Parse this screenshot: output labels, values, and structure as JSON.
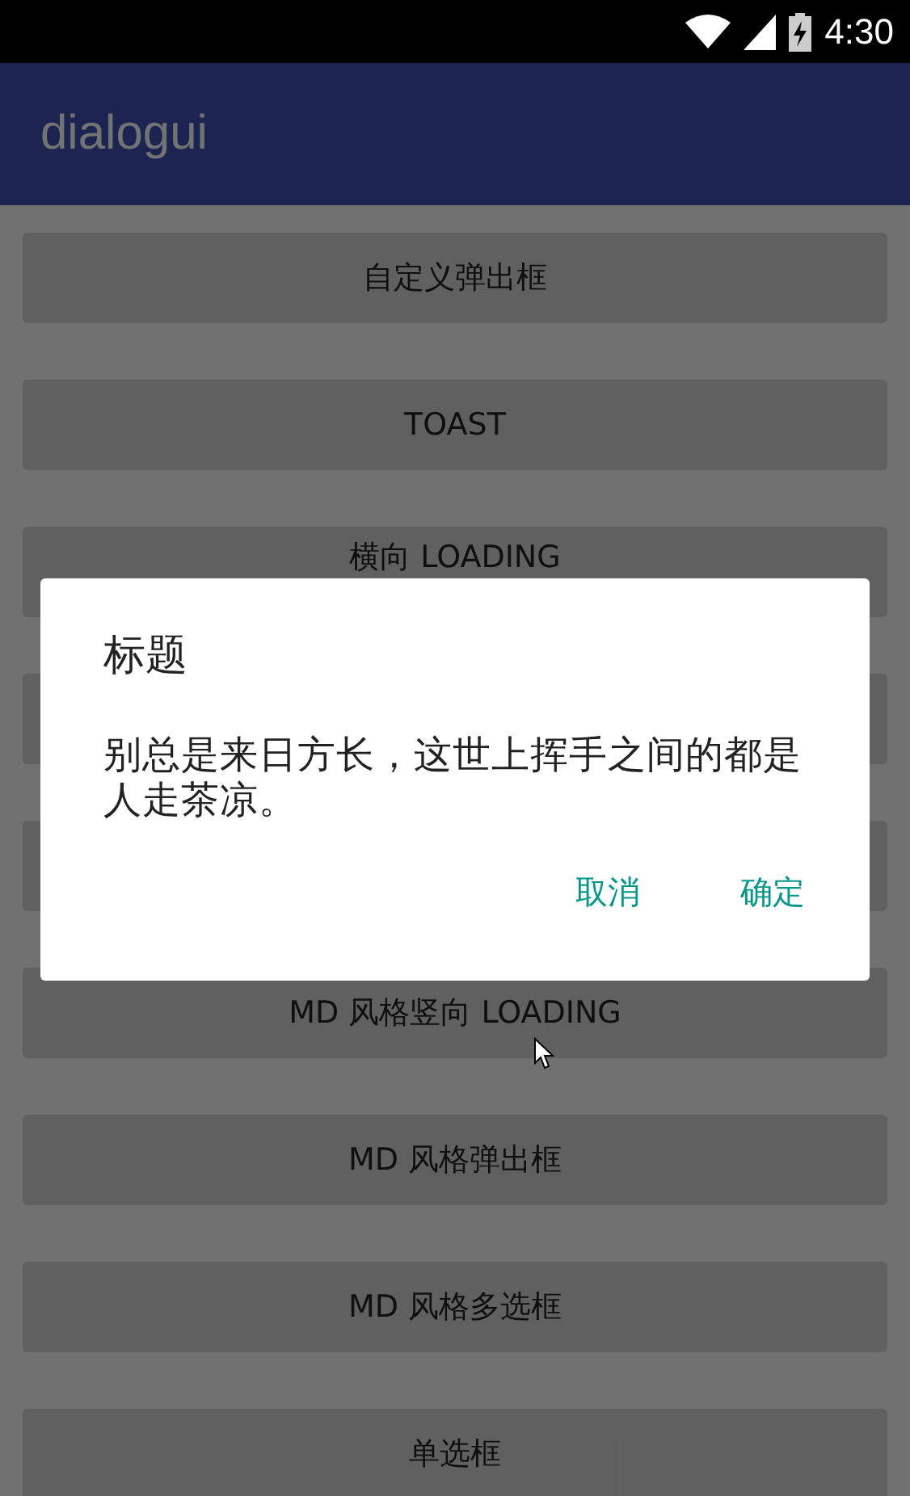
{
  "status_bar": {
    "time": "4:30"
  },
  "app_bar": {
    "title": "dialogui"
  },
  "buttons": [
    {
      "kind": "plain",
      "label": "自定义弹出框"
    },
    {
      "kind": "plain",
      "label": "TOAST"
    },
    {
      "kind": "overlapped",
      "label": "横向 LOADING"
    },
    {
      "kind": "hidden"
    },
    {
      "kind": "hidden"
    },
    {
      "kind": "plain",
      "label": "MD 风格竖向 LOADING"
    },
    {
      "kind": "plain",
      "label": "MD 风格弹出框"
    },
    {
      "kind": "plain",
      "label": "MD 风格多选框"
    },
    {
      "kind": "plain",
      "label": "单选框"
    }
  ],
  "dialog": {
    "title": "标题",
    "message": "别总是来日方长，这世上挥手之间的都是人走茶凉。",
    "actions": [
      "取消",
      "确定"
    ]
  }
}
